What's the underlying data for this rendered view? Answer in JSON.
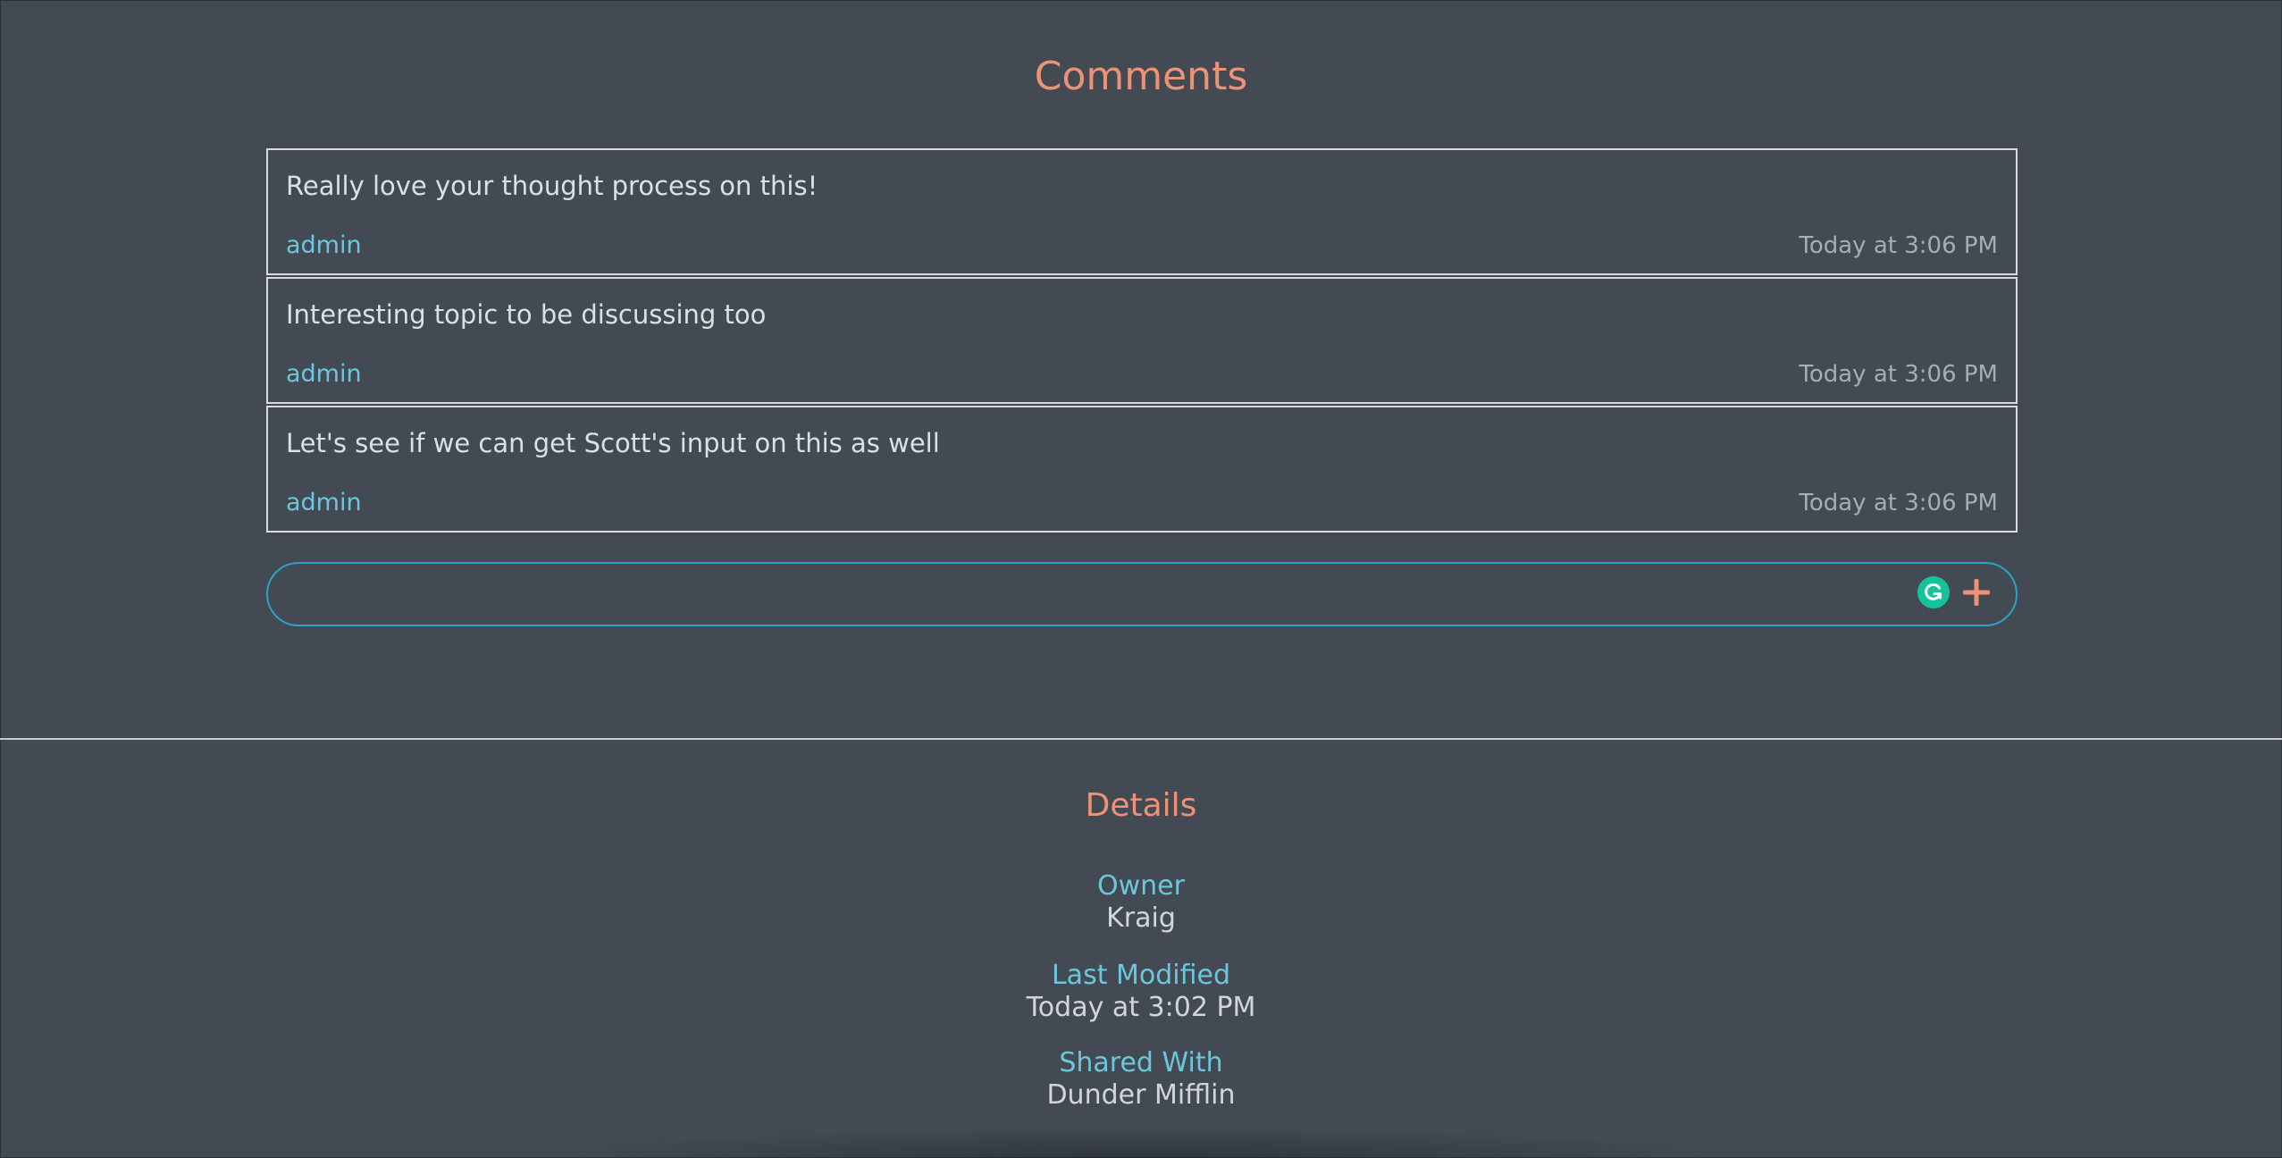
{
  "comments": {
    "title": "Comments",
    "items": [
      {
        "text": "Really love your thought process on this!",
        "author": "admin",
        "time": "Today at 3:06 PM"
      },
      {
        "text": "Interesting topic to be discussing too",
        "author": "admin",
        "time": "Today at 3:06 PM"
      },
      {
        "text": "Let's see if we can get Scott's input on this as well",
        "author": "admin",
        "time": "Today at 3:06 PM"
      }
    ],
    "input": {
      "value": "",
      "placeholder": ""
    },
    "grammarly_icon": "grammarly-g-icon",
    "add_icon": "plus-icon"
  },
  "details": {
    "title": "Details",
    "owner_label": "Owner",
    "owner_value": "Kraig",
    "modified_label": "Last Modified",
    "modified_value": "Today at 3:02 PM",
    "shared_label": "Shared With",
    "shared_value": "Dunder Mifflin"
  },
  "colors": {
    "background": "#434a54",
    "accent": "#ee9275",
    "label": "#6cc6dc",
    "input_border": "#2aa3c6",
    "grammarly": "#15c39a"
  }
}
